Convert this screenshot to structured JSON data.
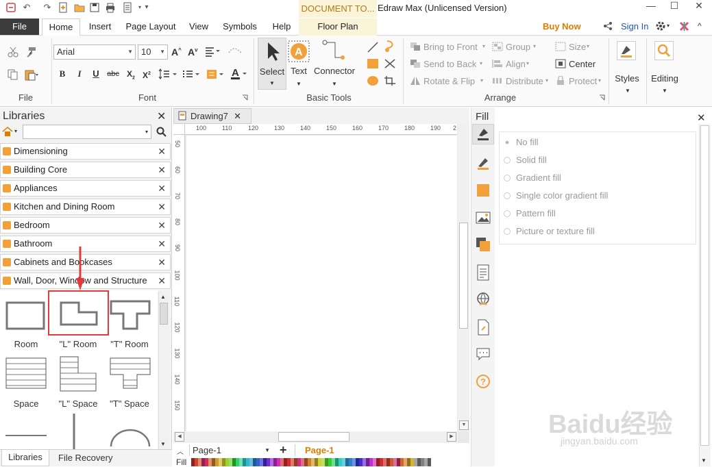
{
  "title_bar": {
    "context_tab": "DOCUMENT TO...",
    "app_title": "Edraw Max (Unlicensed Version)",
    "minimize": "—",
    "maximize": "☐",
    "close": "✕"
  },
  "menu": {
    "file": "File",
    "tabs": [
      "Home",
      "Insert",
      "Page Layout",
      "View",
      "Symbols",
      "Help",
      "Floor Plan"
    ],
    "buy_now": "Buy Now",
    "sign_in": "Sign In",
    "collapse": "^"
  },
  "ribbon": {
    "file_group": "File",
    "font": {
      "name": "Arial",
      "size": "10",
      "group_label": "Font"
    },
    "basic_tools": {
      "select": "Select",
      "text": "Text",
      "connector": "Connector",
      "group_label": "Basic Tools"
    },
    "arrange": {
      "bring_to_front": "Bring to Front",
      "send_to_back": "Send to Back",
      "rotate_flip": "Rotate & Flip",
      "group": "Group",
      "align": "Align",
      "distribute": "Distribute",
      "size": "Size",
      "center": "Center",
      "protect": "Protect",
      "group_label": "Arrange"
    },
    "styles": "Styles",
    "editing": "Editing"
  },
  "libraries": {
    "title": "Libraries",
    "search_placeholder": "",
    "items": [
      "Dimensioning",
      "Building Core",
      "Appliances",
      "Kitchen and Dining Room",
      "Bedroom",
      "Bathroom",
      "Cabinets and Bookcases",
      "Wall, Door, Window and Structure"
    ],
    "shapes": [
      "Room",
      "\"L\" Room",
      "\"T\" Room",
      "Space",
      "\"L\" Space",
      "\"T\" Space"
    ],
    "bottom_tabs": [
      "Libraries",
      "File Recovery"
    ]
  },
  "canvas": {
    "doc_tab": "Drawing7",
    "h_ruler": [
      "100",
      "110",
      "120",
      "130",
      "140",
      "150",
      "160",
      "170",
      "180",
      "190",
      "2"
    ],
    "v_ruler": [
      "50",
      "60",
      "70",
      "80",
      "90",
      "100",
      "110",
      "120",
      "130",
      "140",
      "150"
    ],
    "page_select": "Page-1",
    "page_tab": "Page-1",
    "fill_label": "Fill"
  },
  "fill_panel": {
    "title": "Fill",
    "options": [
      "No fill",
      "Solid fill",
      "Gradient fill",
      "Single color gradient fill",
      "Pattern fill",
      "Picture or texture fill"
    ],
    "selected": "No fill"
  },
  "watermark": {
    "text1": "Baidu经验",
    "text2": "jingyan.baidu.com"
  },
  "colors": {
    "accent": "#f2a03a",
    "highlight": "#e23a3a",
    "link": "#1e5aa8",
    "buy": "#e07b00"
  }
}
